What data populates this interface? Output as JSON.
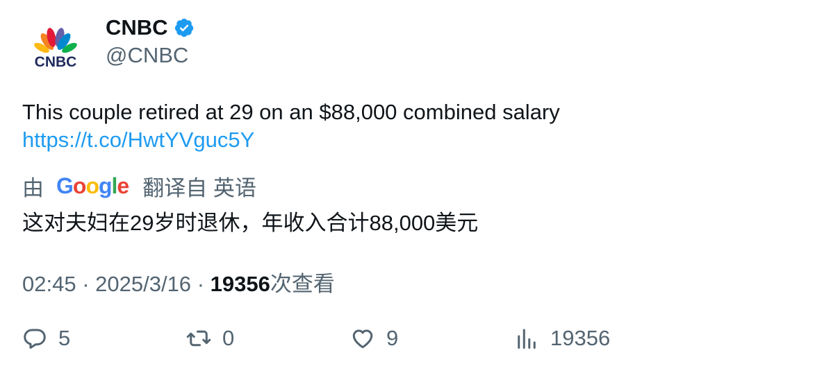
{
  "author": {
    "name": "CNBC",
    "handle": "@CNBC",
    "logo_text": "CNBC",
    "verified": true
  },
  "tweet": {
    "text": "This couple retired at 29 on an $88,000 combined salary",
    "link": "https://t.co/HwtYVguc5Y"
  },
  "translation": {
    "prefix": "由",
    "provider": "Google",
    "suffix": "翻译自 英语",
    "text": "这对夫妇在29岁时退休，年收入合计88,000美元"
  },
  "meta": {
    "time": "02:45",
    "date": "2025/3/16",
    "views_count": "19356",
    "views_label": "次查看"
  },
  "actions": {
    "replies": "5",
    "retweets": "0",
    "likes": "9",
    "views": "19356"
  },
  "colors": {
    "link": "#1d9bf0",
    "secondary": "#536471",
    "verified": "#1d9bf0",
    "cnbc_navy": "#1f2a5c"
  },
  "icons": [
    "cnbc-peacock-logo",
    "verified-badge-icon",
    "reply-icon",
    "retweet-icon",
    "like-icon",
    "views-icon"
  ]
}
